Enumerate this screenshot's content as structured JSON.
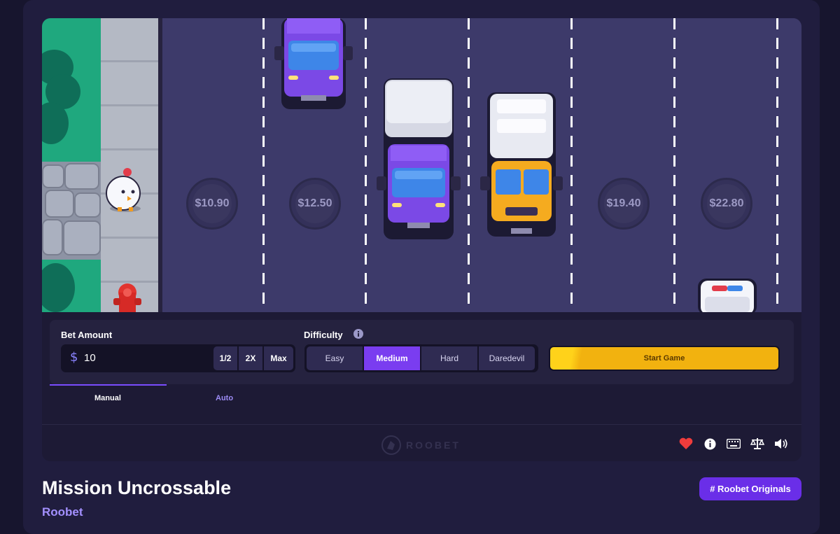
{
  "game": {
    "multipliers": [
      "$10.90",
      "$12.50",
      "$19.40",
      "$22.80"
    ]
  },
  "controls": {
    "bet_label": "Bet Amount",
    "currency": "$",
    "bet_value": "10",
    "half": "1/2",
    "double": "2X",
    "max": "Max",
    "difficulty_label": "Difficulty",
    "difficulties": [
      "Easy",
      "Medium",
      "Hard",
      "Daredevil"
    ],
    "selected_difficulty": "Medium",
    "start": "Start Game"
  },
  "tabs": [
    "Manual",
    "Auto"
  ],
  "footer": {
    "brand": "ROOBET"
  },
  "info": {
    "title": "Mission Uncrossable",
    "provider": "Roobet",
    "tag": "# Roobet Originals"
  },
  "colors": {
    "accent": "#7a3df0",
    "start": "#f2b20f",
    "tag": "#6a2ee8"
  }
}
